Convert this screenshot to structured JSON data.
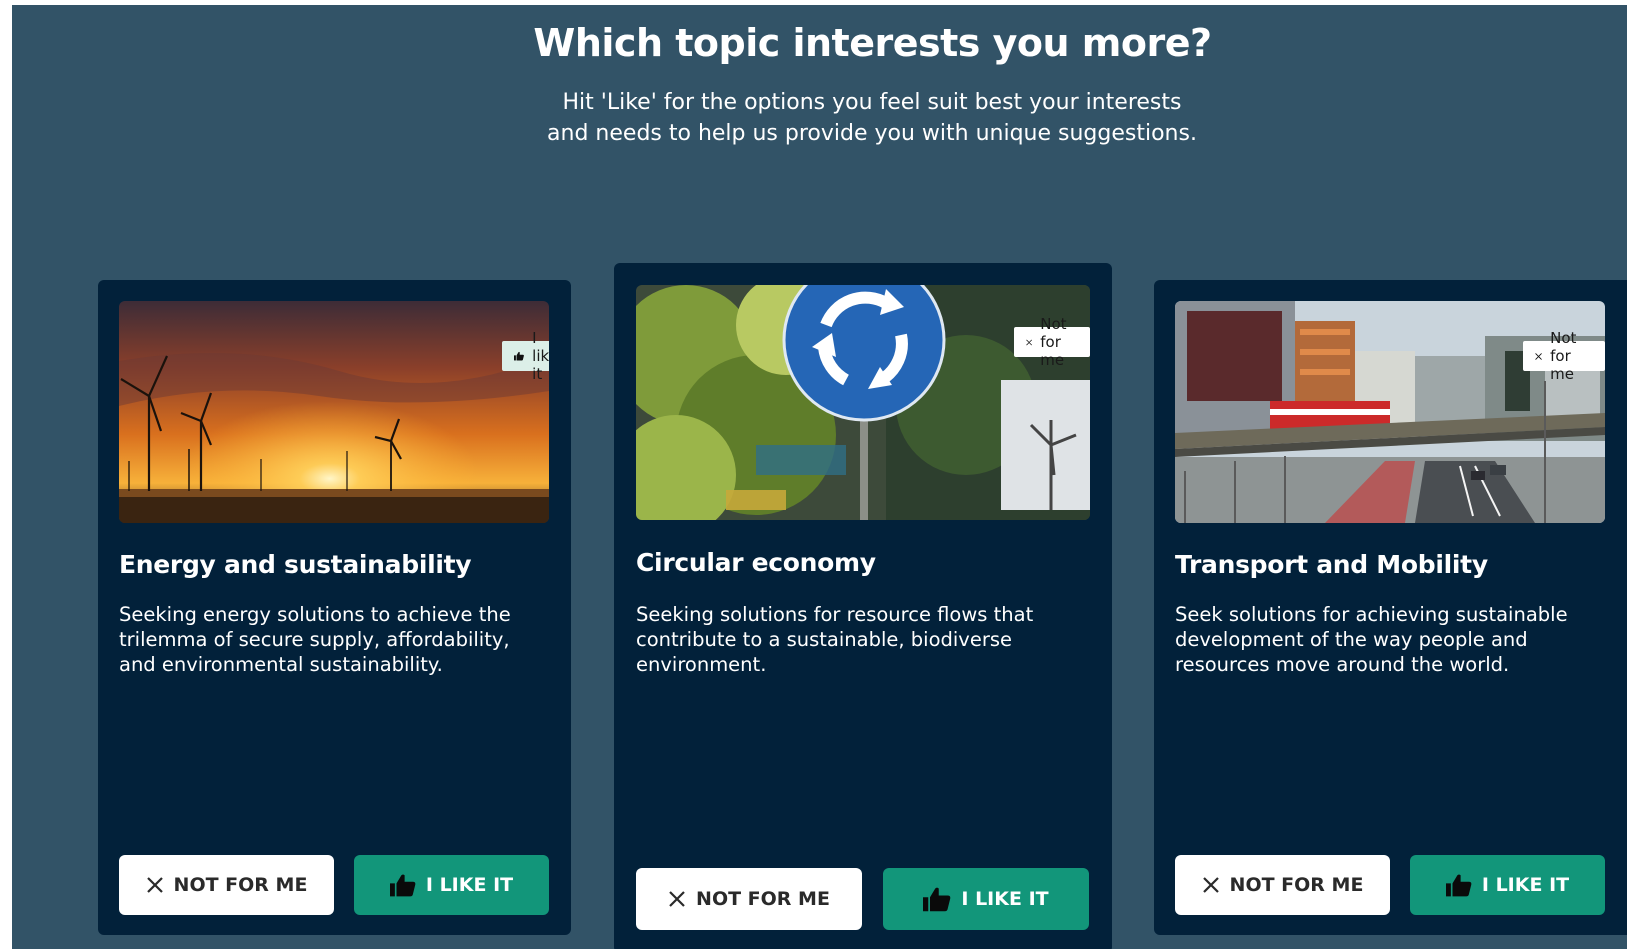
{
  "page": {
    "title": "Which topic interests you more?",
    "subtitle": "Hit 'Like' for the options you feel suit best your interests and needs to help us provide you with unique suggestions."
  },
  "colors": {
    "page_background": "#325367",
    "card_background": "#02213a",
    "like_green": "#12967a",
    "like_badge_background": "#dcefe8"
  },
  "cards": [
    {
      "title": "Energy and sustainability",
      "description": "Seeking energy solutions to achieve the trilemma of secure supply, affordability, and environmental sustainability.",
      "image": "wind-turbines-sunset",
      "status_badge": {
        "label": "I like it",
        "icon": "thumbs-up-icon"
      },
      "not_for_me_label": "NOT FOR ME",
      "like_label": "I LIKE IT"
    },
    {
      "title": "Circular economy",
      "description": "Seeking solutions for resource flows that contribute to a sustainable, biodiverse environment.",
      "image": "roundabout-sign",
      "status_badge": {
        "label": "Not for me",
        "icon": "close-icon"
      },
      "not_for_me_label": "NOT FOR ME",
      "like_label": "I LIKE IT"
    },
    {
      "title": "Transport and Mobility",
      "description": "Seek solutions for achieving sustainable development of the way people and resources move around the world.",
      "image": "city-tram-overpass",
      "status_badge": {
        "label": "Not for me",
        "icon": "close-icon"
      },
      "not_for_me_label": "NOT FOR ME",
      "like_label": "I LIKE IT"
    }
  ]
}
